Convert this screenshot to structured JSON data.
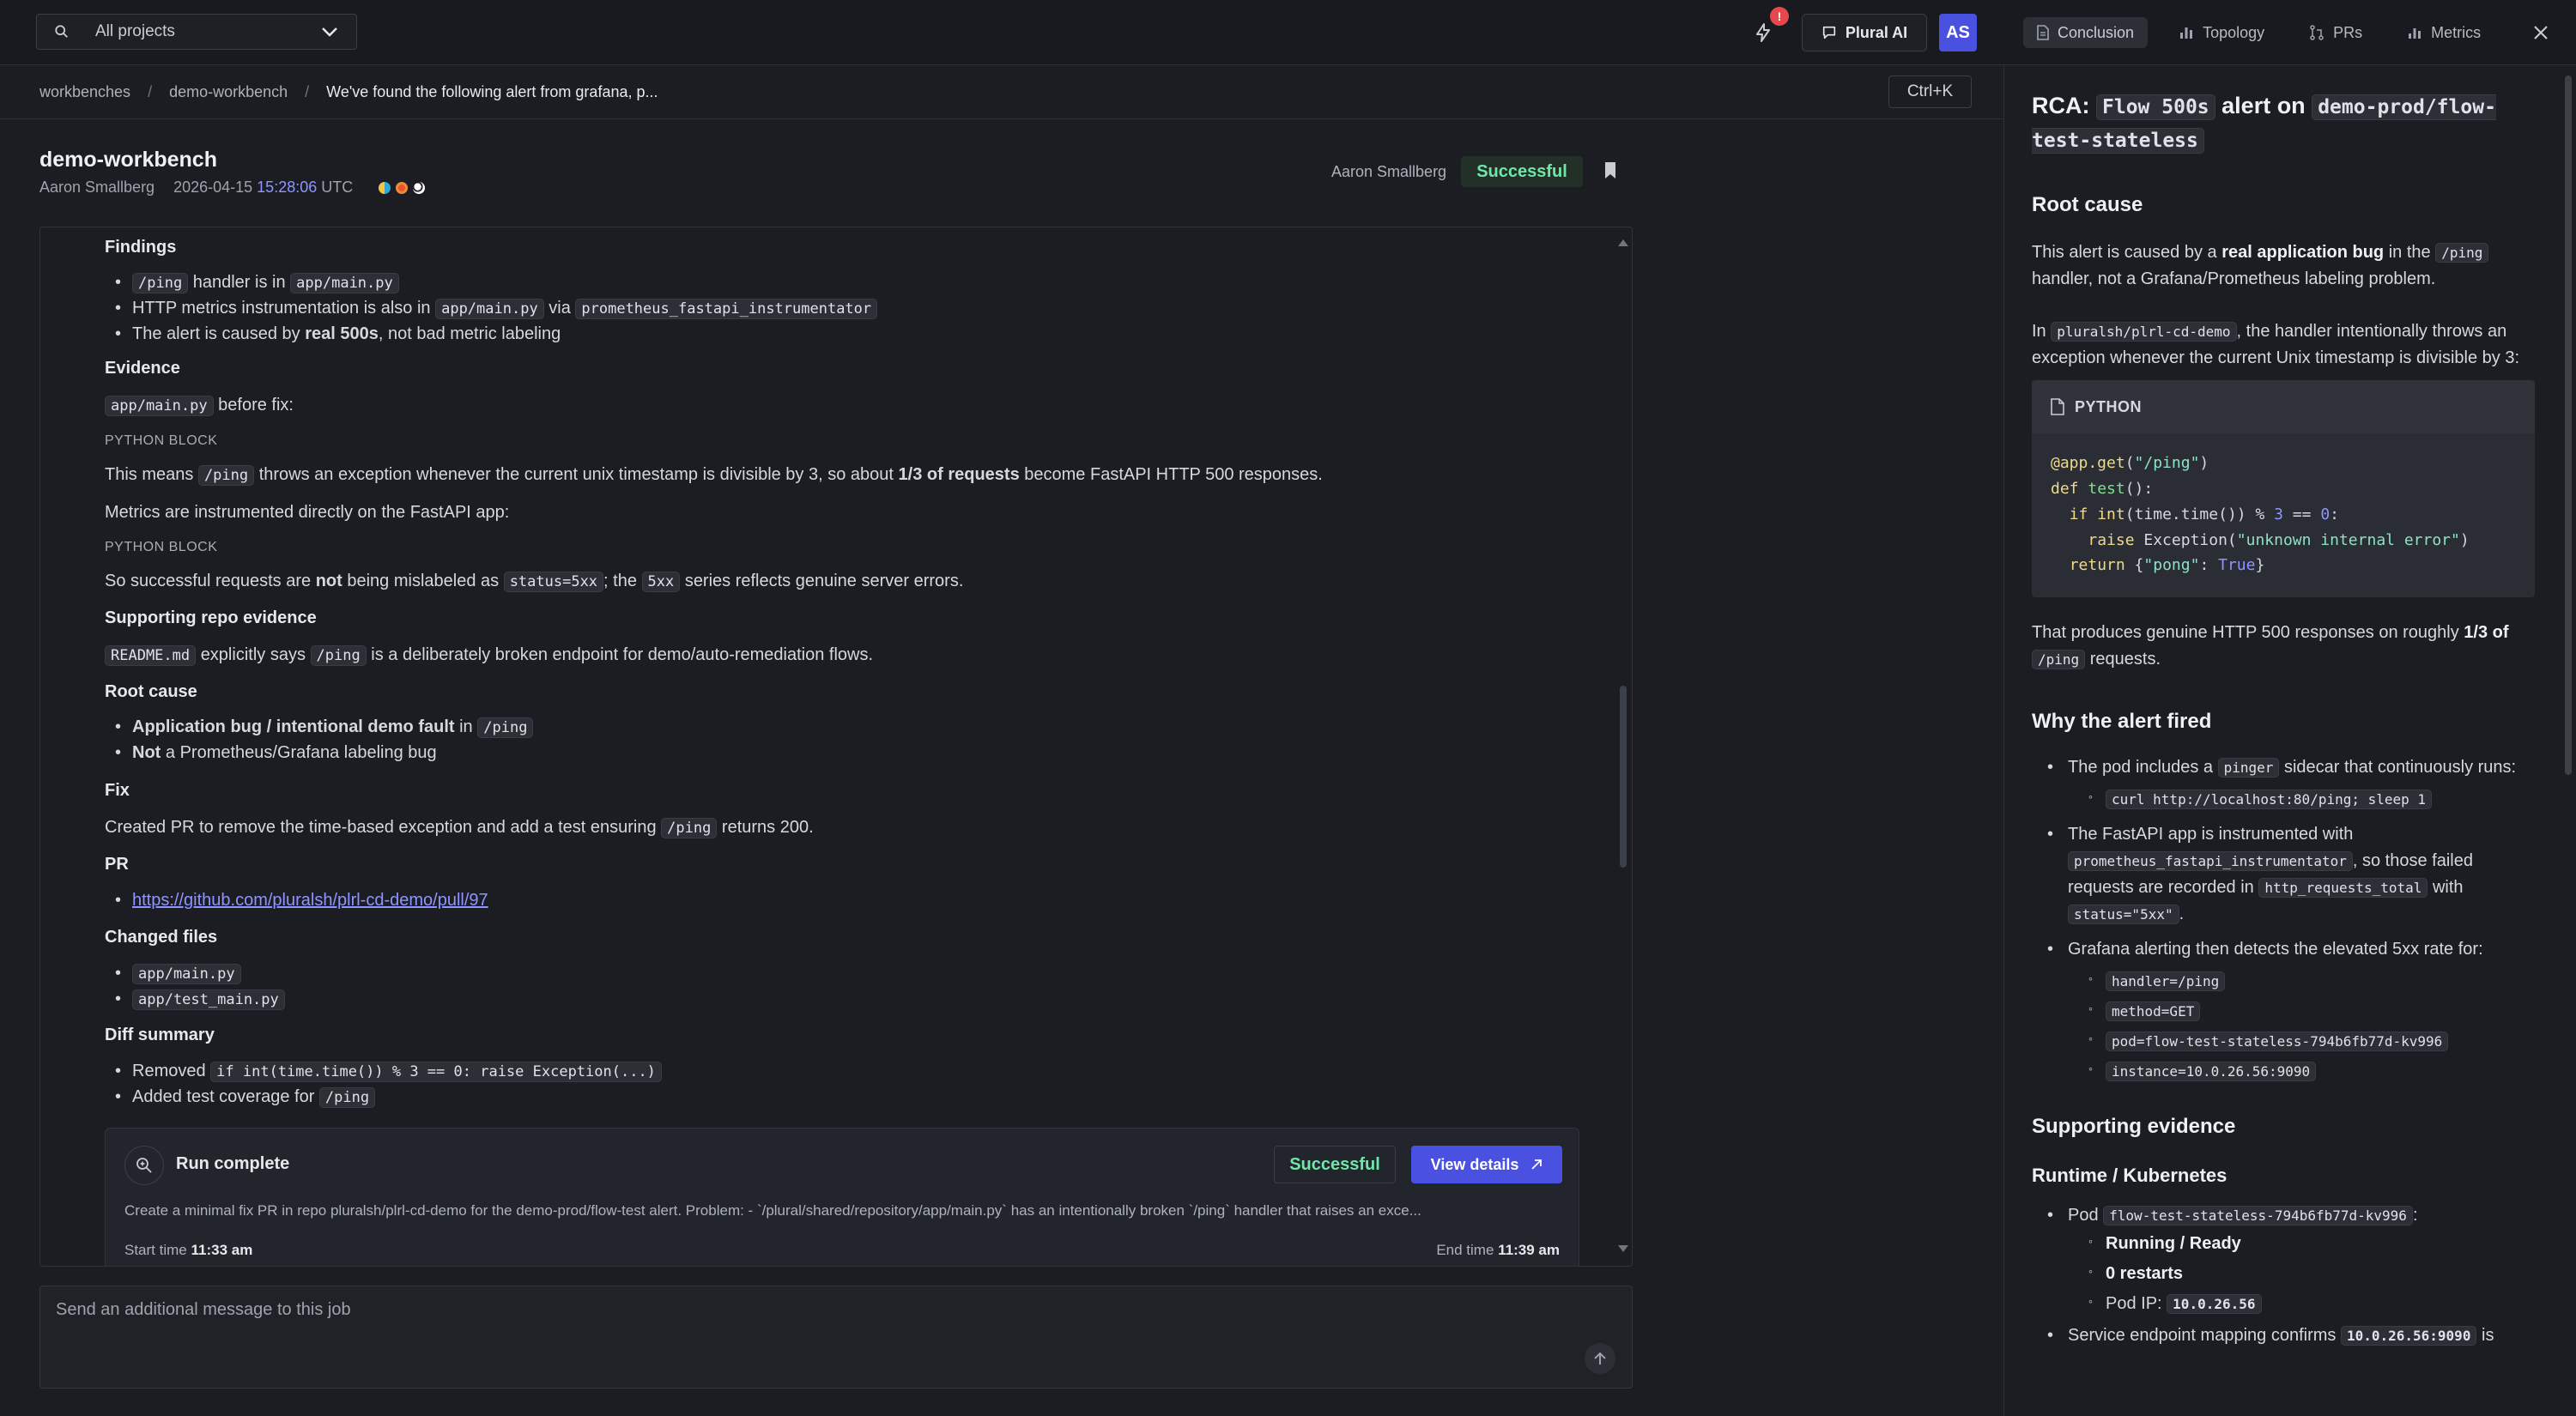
{
  "topbar": {
    "project_select": "All projects",
    "notification_badge": "!",
    "plural_ai": "Plural AI",
    "avatar": "AS",
    "tabs": [
      "Conclusion",
      "Topology",
      "PRs",
      "Metrics"
    ],
    "icons": [
      "search-icon",
      "chevron-down-icon",
      "activity-icon",
      "chat-icon",
      "file-icon",
      "bar-chart-icon",
      "pull-request-icon",
      "close-icon"
    ]
  },
  "breadcrumb": {
    "items": [
      "workbenches",
      "demo-workbench",
      "We've found the following alert from grafana, p..."
    ],
    "separator": "/",
    "shortcut": "Ctrl+K"
  },
  "header": {
    "title": "demo-workbench",
    "author": "Aaron Smallberg",
    "date": "2026-04-15",
    "time": "15:28:06",
    "tz": "UTC",
    "user": "Aaron Smallberg",
    "status": "Successful",
    "tool_icon_colors": [
      "#34a7d3",
      "#e8552b",
      "#ffffff"
    ]
  },
  "main": {
    "findings_h": "Findings",
    "f1_code": "/ping",
    "f1_mid": "handler is in",
    "f1_code2": "app/main.py",
    "f2_pre": "HTTP metrics instrumentation is also in",
    "f2_code": "app/main.py",
    "f2_mid": "via",
    "f2_code2": "prometheus_fastapi_instrumentator",
    "f3_pre": "The alert is caused by",
    "f3_bold": "real 500s",
    "f3_post": ", not bad metric labeling",
    "evidence_h": "Evidence",
    "ev_code": "app/main.py",
    "ev_post": "before fix:",
    "python_block": "PYTHON BLOCK",
    "means_pre": "This means",
    "means_code": "/ping",
    "means_mid": "throws an exception whenever the current unix timestamp is divisible by 3, so about",
    "means_bold": "1/3 of requests",
    "means_post": "become FastAPI HTTP 500 responses.",
    "metrics_line": "Metrics are instrumented directly on the FastAPI app:",
    "python_block2": "PYTHON BLOCK",
    "so_pre": "So successful requests are",
    "so_bold": "not",
    "so_mid": "being mislabeled as",
    "so_code": "status=5xx",
    "so_mid2": "; the",
    "so_code2": "5xx",
    "so_post": "series reflects genuine server errors.",
    "support_h": "Supporting repo evidence",
    "readme_code": "README.md",
    "readme_mid": "explicitly says",
    "readme_code2": "/ping",
    "readme_post": "is a deliberately broken endpoint for demo/auto-remediation flows.",
    "root_h": "Root cause",
    "rc1_bold": "Application bug / intentional demo fault",
    "rc1_mid": "in",
    "rc1_code": "/ping",
    "rc2_bold": "Not",
    "rc2_post": "a Prometheus/Grafana labeling bug",
    "fix_h": "Fix",
    "fix_pre": "Created PR to remove the time-based exception and add a test ensuring",
    "fix_code": "/ping",
    "fix_post": "returns 200.",
    "pr_h": "PR",
    "pr_link": "https://github.com/pluralsh/plrl-cd-demo/pull/97",
    "changed_h": "Changed files",
    "changed": [
      "app/main.py",
      "app/test_main.py"
    ],
    "diff_h": "Diff summary",
    "diff1_pre": "Removed",
    "diff1_code": "if int(time.time()) % 3 == 0: raise Exception(...)",
    "diff2_pre": "Added test coverage for",
    "diff2_code": "/ping"
  },
  "run": {
    "title": "Run complete",
    "status": "Successful",
    "view": "View details",
    "desc": "Create a minimal fix PR in repo pluralsh/plrl-cd-demo for the demo-prod/flow-test alert. Problem: - `/plural/shared/repository/app/main.py` has an intentionally broken `/ping` handler that raises an exce...",
    "start_label": "Start time",
    "start": "11:33 am",
    "end_label": "End time",
    "end": "11:39 am"
  },
  "input": {
    "placeholder": "Send an additional message to this job"
  },
  "rca": {
    "t_pre": "RCA:",
    "t_code": "Flow 500s",
    "t_mid": "alert on",
    "t_code2": "demo-prod/flow-test-stateless",
    "root_h": "Root cause",
    "p1_pre": "This alert is caused by a",
    "p1_bold": "real application bug",
    "p1_mid": "in the",
    "p1_code": "/ping",
    "p1_post": "handler, not a Grafana/Prometheus labeling problem.",
    "p2_pre": "In",
    "p2_code": "pluralsh/plrl-cd-demo",
    "p2_post": ", the handler intentionally throws an exception whenever the current Unix timestamp is divisible by 3:",
    "code_lang": "PYTHON",
    "p3_pre": "That produces genuine HTTP 500 responses on roughly",
    "p3_bold": "1/3 of",
    "p3_code": "/ping",
    "p3_post": "requests.",
    "why_h": "Why the alert fired",
    "w1_pre": "The pod includes a",
    "w1_code": "pinger",
    "w1_post": "sidecar that continuously runs:",
    "w1_sub": "curl http://localhost:80/ping; sleep 1",
    "w2_pre": "The FastAPI app is instrumented with",
    "w2_code": "prometheus_fastapi_instrumentator",
    "w2_mid": ", so those failed requests are recorded in",
    "w2_code2": "http_requests_total",
    "w2_mid2": "with",
    "w2_code3": "status=\"5xx\"",
    "w2_post": ".",
    "w3": "Grafana alerting then detects the elevated 5xx rate for:",
    "w3_subs": [
      "handler=/ping",
      "method=GET",
      "pod=flow-test-stateless-794b6fb77d-kv996",
      "instance=10.0.26.56:9090"
    ],
    "support_h": "Supporting evidence",
    "runtime_h": "Runtime / Kubernetes",
    "s1_pre": "Pod",
    "s1_code": "flow-test-stateless-794b6fb77d-kv996",
    "s1_post": ":",
    "s1_subs": [
      "Running / Ready",
      "0 restarts"
    ],
    "s1_ip_pre": "Pod IP:",
    "s1_ip": "10.0.26.56",
    "s2_pre": "Service endpoint mapping confirms",
    "s2_code": "10.0.26.56:9090",
    "s2_post": "is"
  }
}
